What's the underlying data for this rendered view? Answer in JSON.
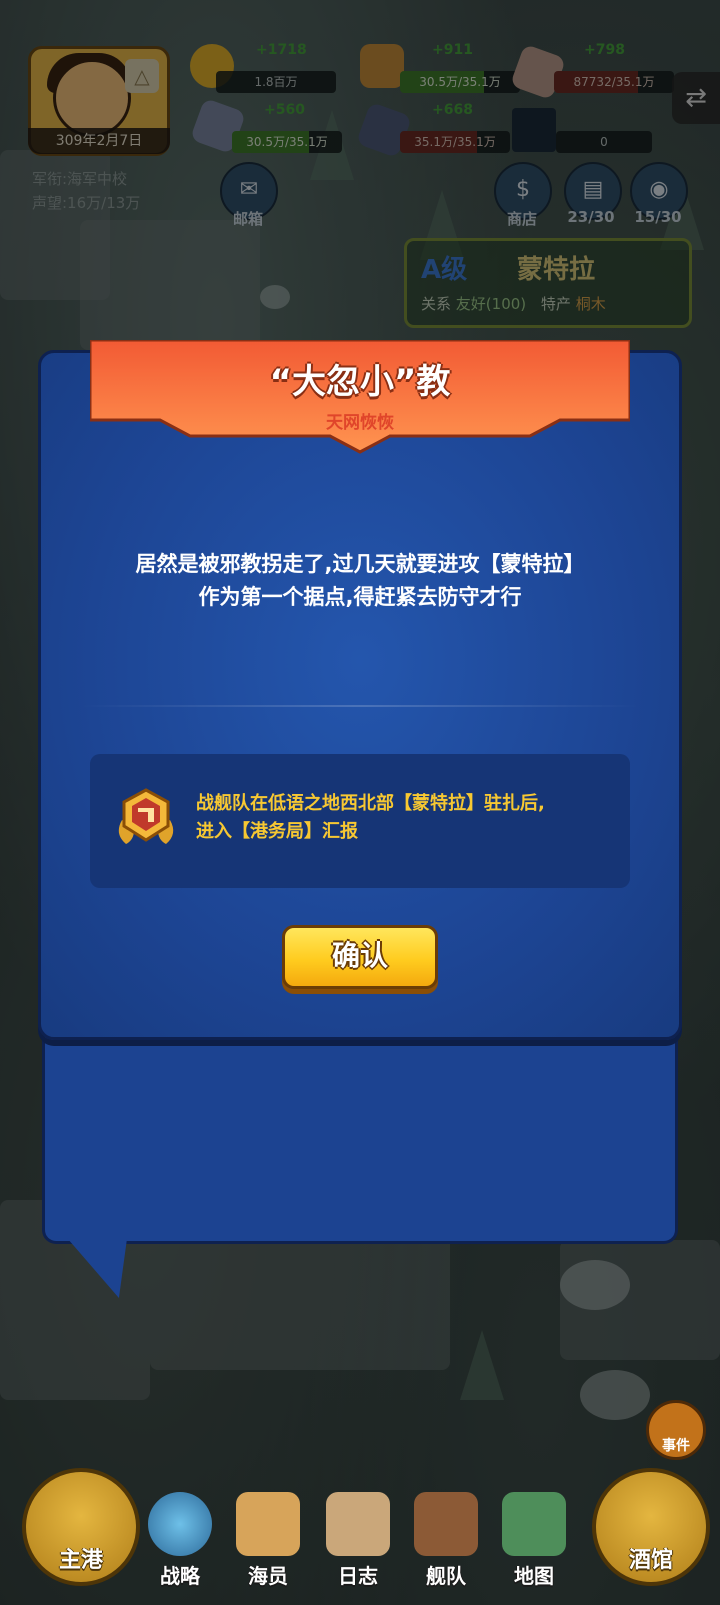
{
  "hud": {
    "date": "309年2月7日",
    "rank": "军衔:海军中校",
    "reputation": "声望:16万/13万",
    "resources": [
      {
        "name": "gold",
        "delta": "+1718",
        "value": "1.8百万",
        "color": "#e0b02a"
      },
      {
        "name": "wood",
        "delta": "+911",
        "value": "30.5万/35.1万",
        "color": "#c48a3a"
      },
      {
        "name": "stone",
        "delta": "+798",
        "value": "87732/35.1万",
        "color": "#b89a8a"
      },
      {
        "name": "iron",
        "delta": "+560",
        "value": "30.5万/35.1万",
        "color": "#7a86a0"
      },
      {
        "name": "crystal",
        "delta": "+668",
        "value": "35.1万/35.1万",
        "color": "#4d5a78"
      },
      {
        "name": "academy",
        "delta": "",
        "value": "0",
        "color": "#1a2a3a"
      }
    ],
    "mailbox_label": "邮箱",
    "shop_label": "商店",
    "book_count": "23/30",
    "bag_count": "15/30",
    "city": {
      "grade": "A级",
      "name": "蒙特拉",
      "relation_label": "关系",
      "relation_value": "友好(100)",
      "specialty_label": "特产",
      "specialty_value": "桐木"
    }
  },
  "dialog": {
    "title": "“大忽小”教",
    "subtitle": "天网恢恢",
    "message_line1": "居然是被邪教拐走了,过几天就要进攻【蒙特拉】",
    "message_line2": "作为第一个据点,得赶紧去防守才行",
    "task_line1": "战舰队在低语之地西北部【蒙特拉】驻扎后,",
    "task_line2": "进入【港务局】汇报",
    "confirm_label": "确认"
  },
  "nav": {
    "main_port": "主港",
    "strategy": "战略",
    "crew": "海员",
    "log": "日志",
    "fleet": "舰队",
    "map": "地图",
    "tavern": "酒馆",
    "event": "事件"
  },
  "colors": {
    "dialog_blue": "#1d4594",
    "ribbon_orange": "#f26a3a",
    "task_gold": "#f7c832",
    "button_yellow": "#ffcc1f"
  }
}
